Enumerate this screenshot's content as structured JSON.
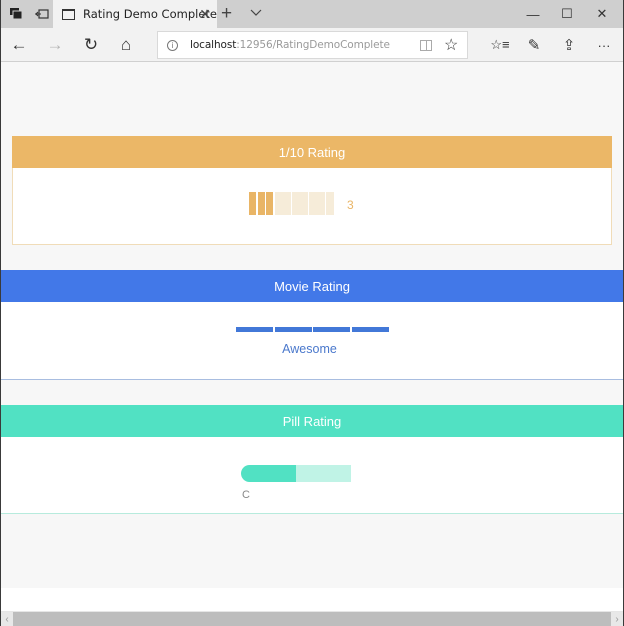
{
  "browser": {
    "tab_title": "Rating Demo Complete",
    "tab_close": "✕",
    "new_tab": "+",
    "url_host": "localhost",
    "url_path": ":12956/RatingDemoComplete",
    "window_controls": {
      "minimize": "—",
      "maximize": "☐",
      "close": "✕"
    },
    "nav_icons": {
      "back": "←",
      "forward": "→",
      "refresh": "↻",
      "home": "⌂",
      "favorite": "☆",
      "favorites_list": "☆≡",
      "notes": "✎",
      "share": "⇪",
      "more": "···"
    }
  },
  "panels": {
    "ten_rating": {
      "title": "1/10 Rating",
      "value": 3,
      "max": 10,
      "value_label": "3",
      "color": "#ebb767"
    },
    "movie_rating": {
      "title": "Movie Rating",
      "value": 4,
      "max": 4,
      "value_label": "Awesome",
      "color": "#4278e8"
    },
    "pill_rating": {
      "title": "Pill Rating",
      "value": 1,
      "max": 2,
      "value_label": "C",
      "color": "#51e1c3"
    }
  },
  "scrollbar": {
    "left": "‹",
    "right": "›"
  }
}
